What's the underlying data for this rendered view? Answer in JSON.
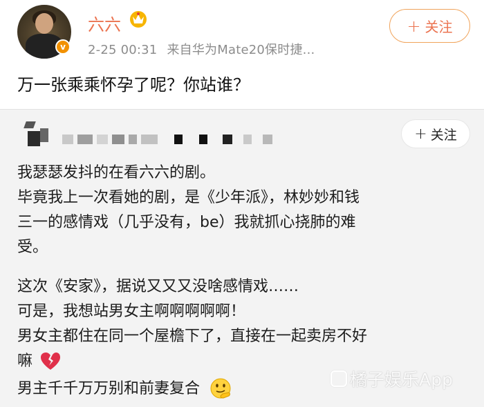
{
  "post": {
    "username": "六六",
    "time": "2-25 00:31",
    "source": "来自华为Mate20保时捷...",
    "follow_label": "关注",
    "follow_plus": "+",
    "text": "万一张乘乘怀孕了呢？你站谁？",
    "verified_icon": "verified-badge-icon",
    "crown_icon": "crown-icon"
  },
  "quoted": {
    "follow_label": "关注",
    "follow_plus": "+",
    "lines": [
      "我瑟瑟发抖的在看六六的剧。",
      "毕竟我上一次看她的剧，是《少年派》，林妙妙和钱",
      "三一的感情戏（几乎没有，be）我就抓心挠肺的难",
      "受。",
      "这次《安家》，据说又又又没啥感情戏……",
      "可是，我想站男女主啊啊啊啊啊！",
      "男女主都住在同一个屋檐下了，直接在一起卖房不好",
      "嘛",
      "男主千千万万别和前妻复合"
    ],
    "heart_icon": "broken-heart-icon",
    "smile_icon": "thinking-face-icon"
  },
  "watermark": {
    "text": "橘子娱乐App"
  },
  "colors": {
    "accent": "#eb7350",
    "badge": "#f29100",
    "meta": "#8c8c8c",
    "card_bg": "#f3f3f3"
  }
}
